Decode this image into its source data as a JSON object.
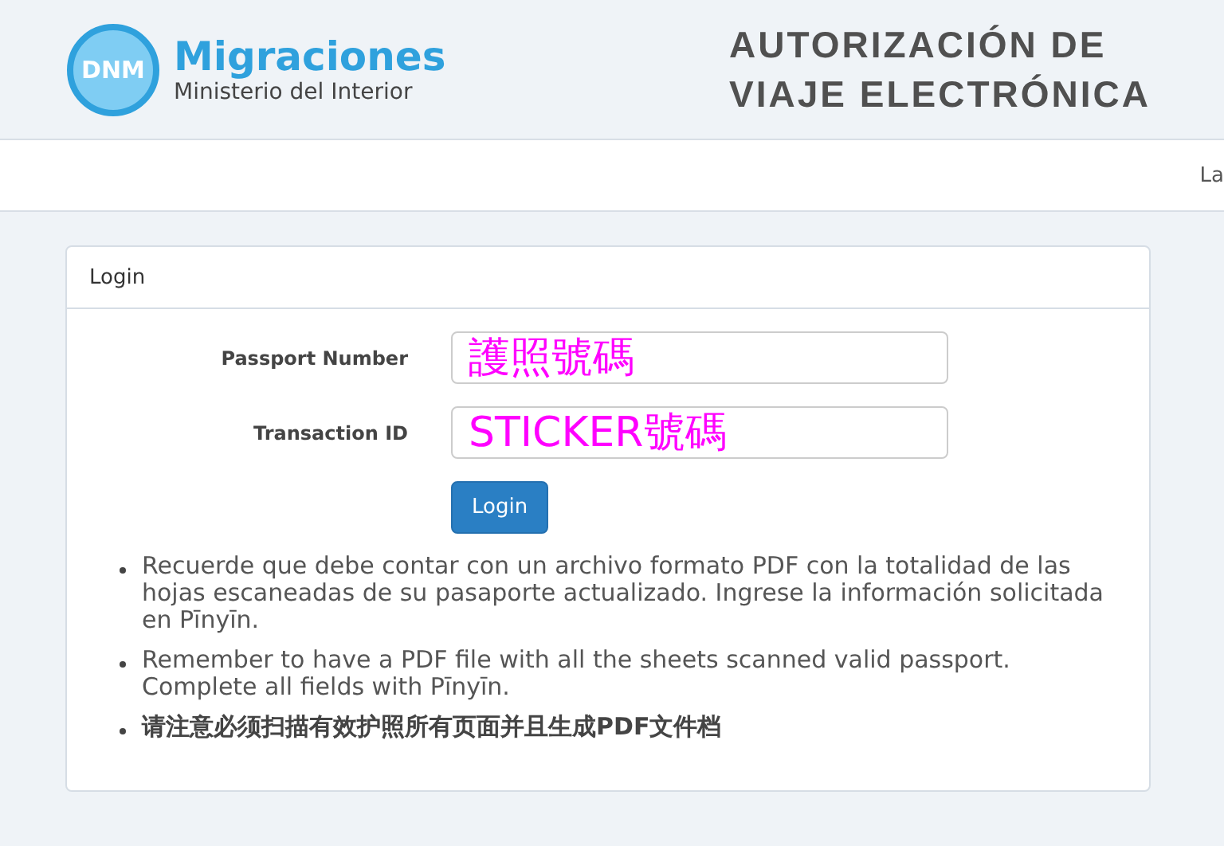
{
  "header": {
    "logo_badge": "DNM",
    "logo_title": "Migraciones",
    "logo_subtitle": "Ministerio del Interior",
    "title_lines": [
      "AUTORIZACIÓN DE",
      "VIAJE ELECTRÓNICA"
    ]
  },
  "nav": {
    "language_link": "La"
  },
  "login": {
    "title": "Login",
    "fields": [
      {
        "label": "Passport Number",
        "value": "護照號碼"
      },
      {
        "label": "Transaction ID",
        "value": "STICKER號碼"
      }
    ],
    "button": "Login",
    "notes": [
      {
        "text": "Recuerde que debe contar con un archivo formato PDF con la totalidad de las hojas escaneadas de su pasaporte actualizado. Ingrese la información solicitada en Pīnyīn.",
        "kind": "normal"
      },
      {
        "text": "Remember to have a PDF file with all the sheets scanned valid passport. Complete all fields with Pīnyīn.",
        "kind": "normal"
      },
      {
        "text": "请注意必须扫描有效护照所有页面并且生成PDF文件档",
        "kind": "bold"
      }
    ]
  }
}
